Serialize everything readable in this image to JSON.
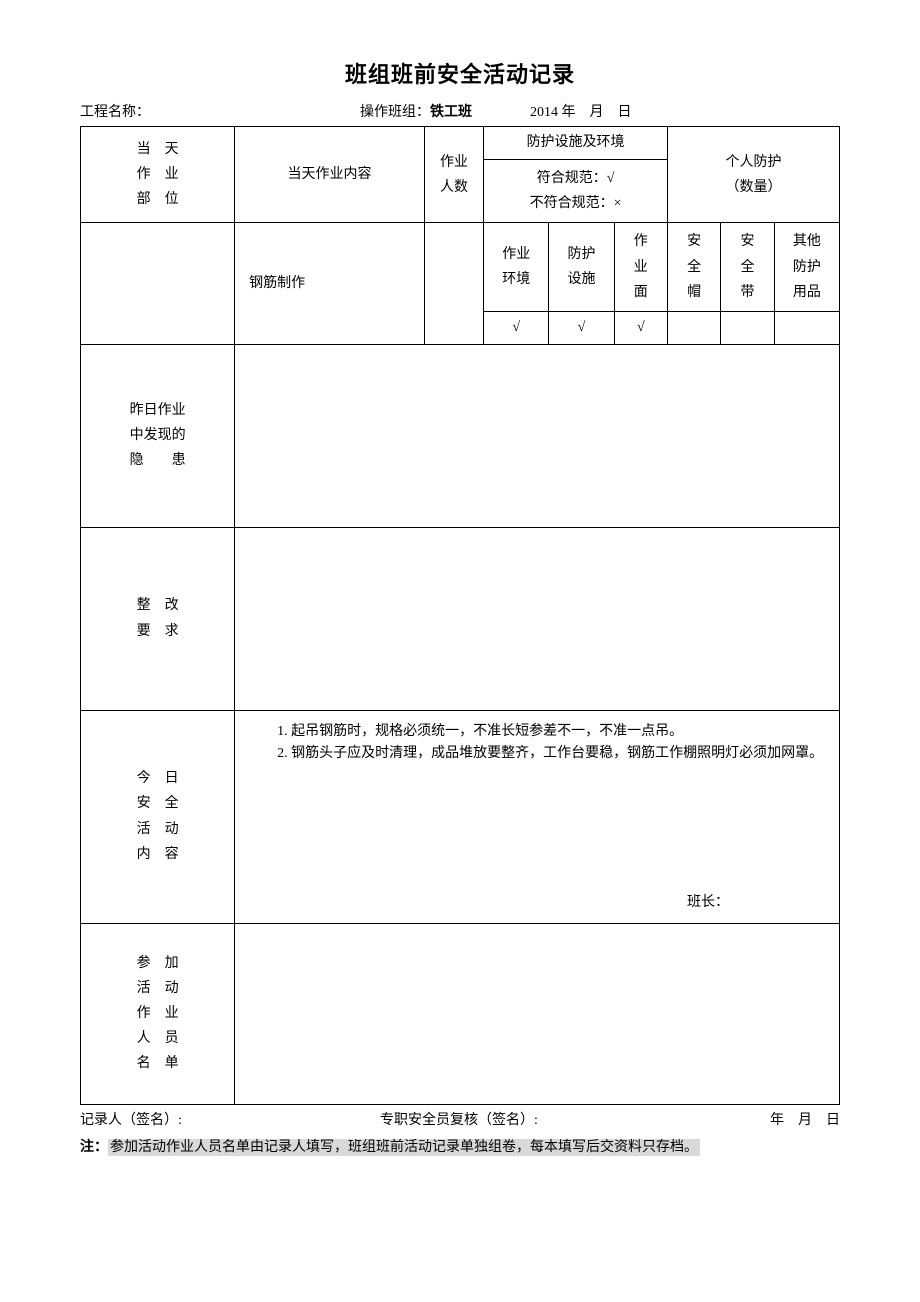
{
  "title": "班组班前安全活动记录",
  "meta": {
    "project_label": "工程名称：",
    "team_label": "操作班组：",
    "team_value": "铁工班",
    "date_text": "2014 年　月　日"
  },
  "headers": {
    "today_part": "当　天\n作　业\n部　位",
    "today_content": "当天作业内容",
    "worker_count": "作业\n人数",
    "protection_env": "防护设施及环境",
    "compliance": "符合规范：√\n不符合规范：×",
    "personal_prot": "个人防护\n（数量）",
    "sub": {
      "env": "作业\n环境",
      "facility": "防护\n设施",
      "face": "作\n业\n面",
      "helmet": "安\n全\n帽",
      "belt": "安\n全\n带",
      "other": "其他\n防护\n用品"
    }
  },
  "row1": {
    "content": "钢筋制作",
    "env_mark": "√",
    "facility_mark": "√",
    "face_mark": "√",
    "helmet_mark": "",
    "belt_mark": "",
    "other_mark": ""
  },
  "yesterday_label": "昨日作业\n中发现的\n隐　　患",
  "yesterday_text": "",
  "rectify_label": "整　改\n要　求",
  "rectify_text": "",
  "today_act_label": "今　日\n安　全\n活　动\n内　容",
  "today_act_text": "　　1. 起吊钢筋时，规格必须统一，不准长短参差不一，不准一点吊。\n　　2. 钢筋头子应及时清理，成品堆放要整齐，工作台要稳，钢筋工作棚照明灯必须加网罩。",
  "leader_label": "班长：",
  "participants_label": "参　加\n活　动\n作　业\n人　员\n名　单",
  "participants_text": "",
  "footer": {
    "recorder": "记录人（签名）:",
    "reviewer": "专职安全员复核（签名）:",
    "date": "年　月　日"
  },
  "note_prefix": "注：",
  "note_body": "参加活动作业人员名单由记录人填写，班组班前活动记录单独组卷，每本填写后交资料只存档。"
}
